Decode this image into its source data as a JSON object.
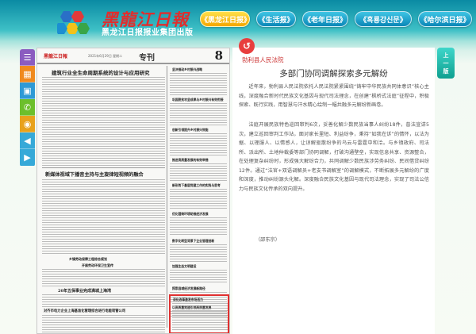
{
  "header": {
    "logo_title": "黑龍江日報",
    "logo_subtitle": "黑龙江日报报业集团出版"
  },
  "nav": {
    "tabs": [
      {
        "label": "《黑龙江日报》",
        "active": true
      },
      {
        "label": "《生活报》",
        "active": false
      },
      {
        "label": "《老年日报》",
        "active": false
      },
      {
        "label": "《흑룡강신문》",
        "active": false
      },
      {
        "label": "《哈尔滨日报》",
        "active": false
      }
    ]
  },
  "sidebar": {
    "buttons": [
      {
        "icon": "menu-icon",
        "color": "#8b5cc0",
        "glyph": "☰"
      },
      {
        "icon": "calendar-icon",
        "color": "#f08a1e",
        "glyph": "▦"
      },
      {
        "icon": "grid-icon",
        "color": "#2e9ad6",
        "glyph": "▣"
      },
      {
        "icon": "wechat-icon",
        "color": "#6cbf2c",
        "glyph": "✆"
      },
      {
        "icon": "weibo-icon",
        "color": "#e8a21c",
        "glyph": "◉"
      },
      {
        "icon": "arrow-left-icon",
        "color": "#36a9d8",
        "glyph": "◀"
      },
      {
        "icon": "arrow-right-icon",
        "color": "#36a9d8",
        "glyph": "▶"
      }
    ]
  },
  "newspaper": {
    "page_logo": "黑龍江日報",
    "page_date": "2021年6月29日 星期二",
    "section_title": "专刊",
    "page_number": "8",
    "headlines": [
      "建筑行业全生命周期系统的设计与应用研究",
      "新媒体视域下播音主持与主旋律短视频的融合",
      "乡镇劳动保障工程综合规划",
      "开展劳动环保卫生宣传",
      "20年五保事业完成满城上海湾",
      "对齐市电力企业上海基准化管理综合进行电能项管公司",
      "坚决推动乡村振兴战略",
      "巩固脱贫攻坚成果与乡村振兴有效衔接",
      "创新引领提升乡村振兴效能",
      "推进高质量发展的有效举措",
      "新形势下基层党建工作的实践与思考",
      "优化营商环境助推经济发展",
      "数字化转型背景下企业管理创新",
      "加强生态文明建设",
      "探索县域经济发展新路径",
      "以高质量党建引领高质量发展",
      "深化改革激发市场活力",
      "勃利县人民法院多部门协同调解"
    ]
  },
  "article": {
    "source": "勃利县人民法院",
    "title": "多部门协同调解探索多元解纷",
    "paragraphs": [
      "近年来，勃利县人民法院依托人民法院紧紧围绕“铸牢中华民族共同体意识”核心主线，深度融合新时代民族文化基因与现代司法理念，在创建“枫桥式法庭”征程中，积极探索、既行实践，用智慧与汗水精心绘制一幅共融多元解纷新画卷。",
      "法庭开展民族特色巡回审判6次，妥善化解少数民族当事人纠纷18件，普法宣讲5次，建立巡回审判工作站，面对家长里短、利益纷争，秉持“如我在诉”的情怀，以法为据、以理服人、以情感人，让谅解驱散纷争的乌云与雷霆中和洽。与乡镇政府、司法所、派出所、土地仲裁委等部门协同调解，打破沟通壁垒，实现信息共享、资源整合，在处理复杂纠纷时，形成强大解纷合力，共同调解少数民族涉劳务纠纷、民间借贷纠纷12件。通过“法官+双语调解员+老支书调解室”的调解模式，不断拓展多元解纷的广度和深度，推动纠纷源头化解。深度融合民族文化基因与现代司法理念，实现了司法公信力与民族文化传承的双向提升。"
    ],
    "signature": "（邵东宗）"
  },
  "prev_button": {
    "line1": "上",
    "line2": "一",
    "line3": "版"
  }
}
